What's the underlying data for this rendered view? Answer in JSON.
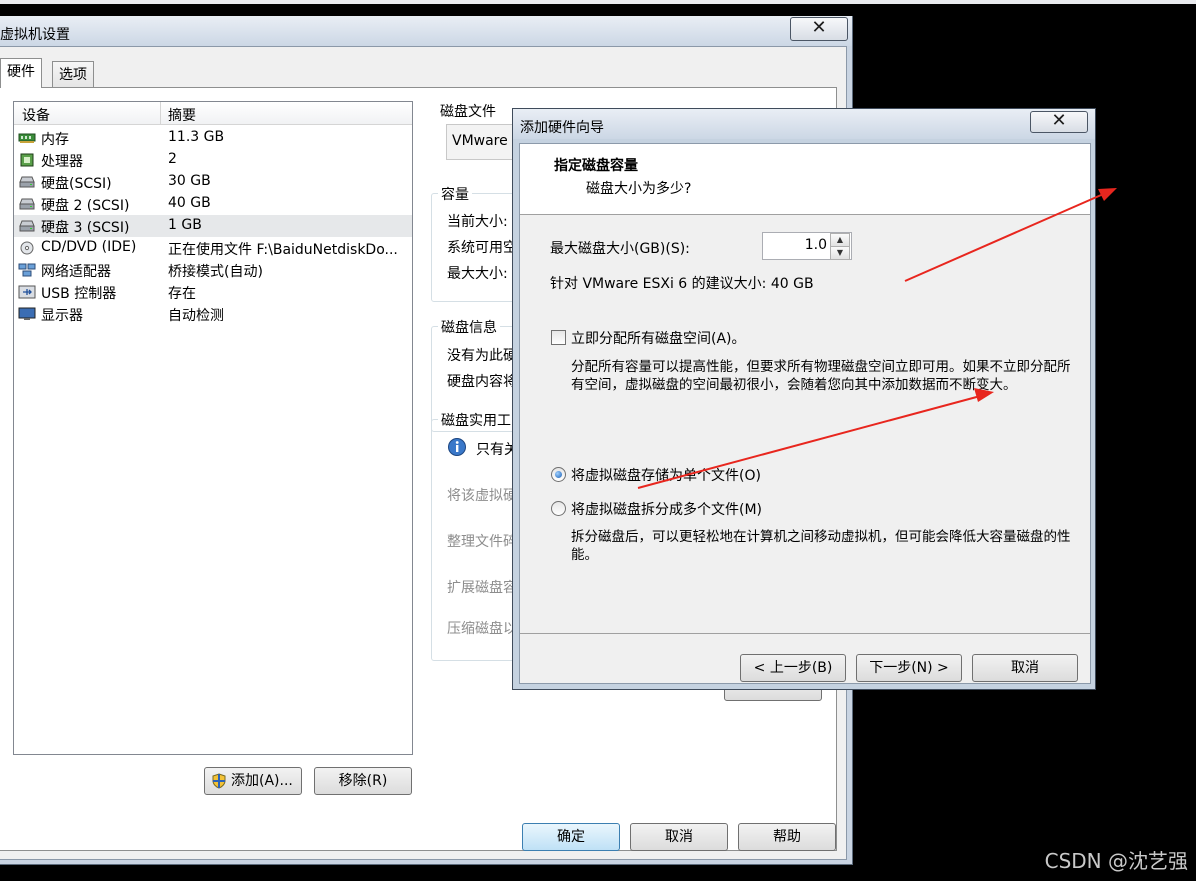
{
  "main_window": {
    "title": "虚拟机设置",
    "tabs": [
      "硬件",
      "选项"
    ],
    "device_list": {
      "headers": [
        "设备",
        "摘要"
      ],
      "rows": [
        {
          "name": "内存",
          "summary": "11.3 GB",
          "icon": "memory-icon"
        },
        {
          "name": "处理器",
          "summary": "2",
          "icon": "cpu-icon"
        },
        {
          "name": "硬盘(SCSI)",
          "summary": "30 GB",
          "icon": "harddisk-icon"
        },
        {
          "name": "硬盘 2 (SCSI)",
          "summary": "40 GB",
          "icon": "harddisk-icon"
        },
        {
          "name": "硬盘 3 (SCSI)",
          "summary": "1 GB",
          "icon": "harddisk-icon",
          "selected": true
        },
        {
          "name": "CD/DVD (IDE)",
          "summary": "正在使用文件 F:\\BaiduNetdiskDo...",
          "icon": "cdrom-icon"
        },
        {
          "name": "网络适配器",
          "summary": "桥接模式(自动)",
          "icon": "network-icon"
        },
        {
          "name": "USB 控制器",
          "summary": "存在",
          "icon": "usb-icon"
        },
        {
          "name": "显示器",
          "summary": "自动检测",
          "icon": "monitor-icon"
        }
      ]
    },
    "add_button": "添加(A)...",
    "remove_button": "移除(R)",
    "disk_file": {
      "label": "磁盘文件",
      "value": "VMware"
    },
    "capacity": {
      "label": "容量",
      "current_size": "当前大小:",
      "system_available": "系统可用空",
      "max_size": "最大大小:"
    },
    "disk_info": {
      "label": "磁盘信息",
      "line1": "没有为此硬",
      "line2": "硬盘内容将"
    },
    "disk_utilities": {
      "label": "磁盘实用工",
      "info": "只有关",
      "map": "将该虚拟硬",
      "defrag": "整理文件碎",
      "expand": "扩展磁盘容",
      "compact": "压缩磁盘以"
    },
    "ok_button": "确定",
    "cancel_button": "取消",
    "help_button": "帮助"
  },
  "wizard": {
    "title": "添加硬件向导",
    "heading": "指定磁盘容量",
    "subheading": "磁盘大小为多少?",
    "max_disk_label": "最大磁盘大小(GB)(S):",
    "max_disk_value": "1.0",
    "recommended": "针对 VMware ESXi 6 的建议大小: 40 GB",
    "allocate_label": "立即分配所有磁盘空间(A)。",
    "allocate_checked": false,
    "allocate_desc": "分配所有容量可以提高性能，但要求所有物理磁盘空间立即可用。如果不立即分配所有空间，虚拟磁盘的空间最初很小，会随着您向其中添加数据而不断变大。",
    "single_file_label": "将虚拟磁盘存储为单个文件(O)",
    "single_file_selected": true,
    "split_label": "将虚拟磁盘拆分成多个文件(M)",
    "split_desc": "拆分磁盘后，可以更轻松地在计算机之间移动虚拟机，但可能会降低大容量磁盘的性能。",
    "back_button": "< 上一步(B)",
    "next_button": "下一步(N) >",
    "cancel_button": "取消"
  },
  "watermark": "CSDN @沈艺强",
  "annotation_color": "#e8261e"
}
